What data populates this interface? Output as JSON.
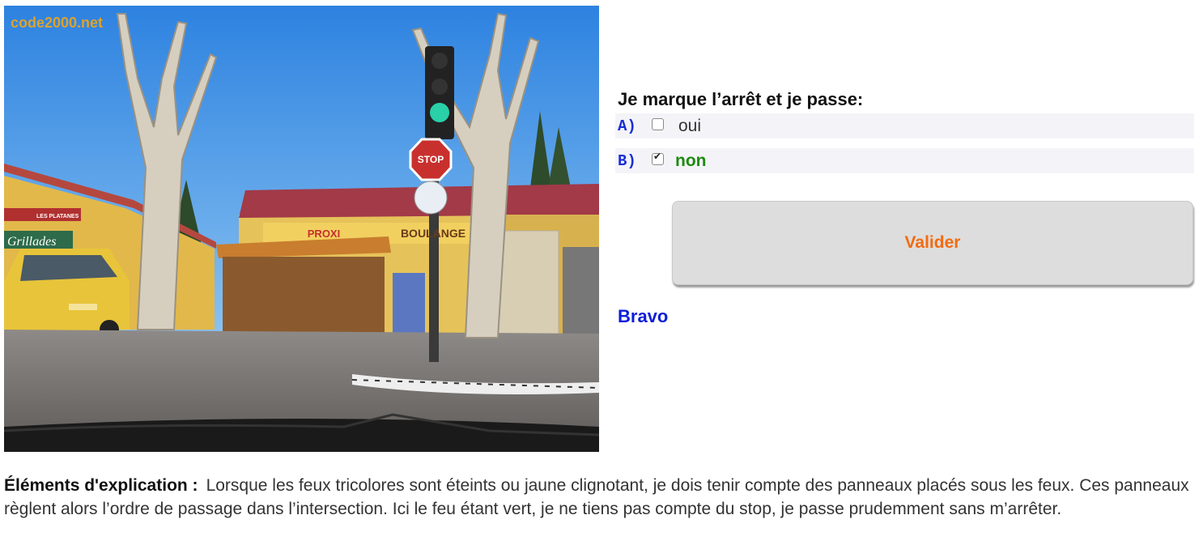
{
  "photo": {
    "watermark": "code2000.net",
    "sign_stop": "STOP",
    "shop_proxi": "PROXI",
    "shop_boulangerie": "BOULANGE",
    "shop_grillades": "Grillades",
    "shop_platanes": "LES PLATANES"
  },
  "question": {
    "text": "Je marque l’arrêt et je passe:",
    "answers": [
      {
        "letter": "A)",
        "text": "oui",
        "checked": false
      },
      {
        "letter": "B)",
        "text": "non",
        "checked": true
      }
    ]
  },
  "validate_label": "Valider",
  "result": "Bravo",
  "explanation": {
    "label": "Éléments d'explication :",
    "text": "Lorsque les feux tricolores sont éteints ou jaune clignotant, je dois tenir compte des panneaux placés sous les feux. Ces panneaux règlent alors l’ordre de passage dans l’intersection. Ici le feu étant vert, je ne tiens pas compte du stop, je passe prudemment sans m’arrêter."
  },
  "colors": {
    "sky": "#3b8ee6",
    "valider_text": "#f26b11",
    "bravo": "#0d1ed8",
    "correct": "#1f8a12",
    "answer_letter": "#1a2fd6"
  }
}
